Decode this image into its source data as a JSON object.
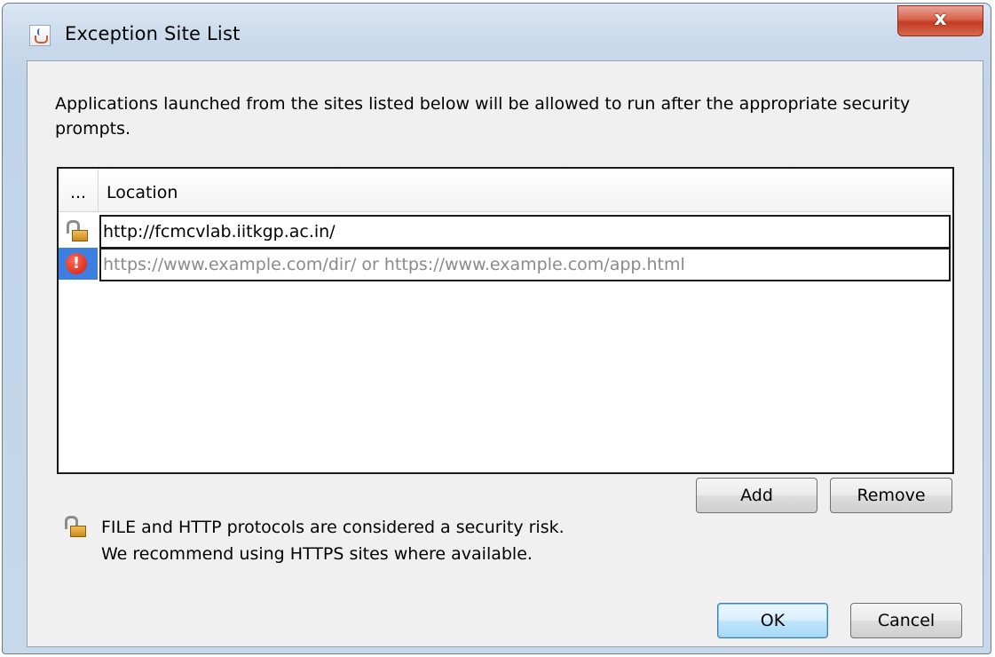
{
  "window": {
    "title": "Exception Site List",
    "close_label": "x"
  },
  "description": "Applications launched from the sites listed below will be allowed to run after the appropriate security prompts.",
  "table": {
    "columns": [
      "...",
      "Location"
    ],
    "rows": [
      {
        "icon": "unlocked-padlock-icon",
        "value": "http://fcmcvlab.iitkgp.ac.in/"
      },
      {
        "icon": "error-icon",
        "placeholder": "https://www.example.com/dir/ or https://www.example.com/app.html"
      }
    ]
  },
  "buttons": {
    "add": "Add",
    "remove": "Remove",
    "ok": "OK",
    "cancel": "Cancel"
  },
  "warning": {
    "line1": "FILE and HTTP protocols are considered a security risk.",
    "line2": "We recommend using HTTPS sites where available."
  },
  "colors": {
    "selection": "#3d7fe0",
    "error": "#d01a0c",
    "placeholder_text": "#8a8a8a"
  }
}
